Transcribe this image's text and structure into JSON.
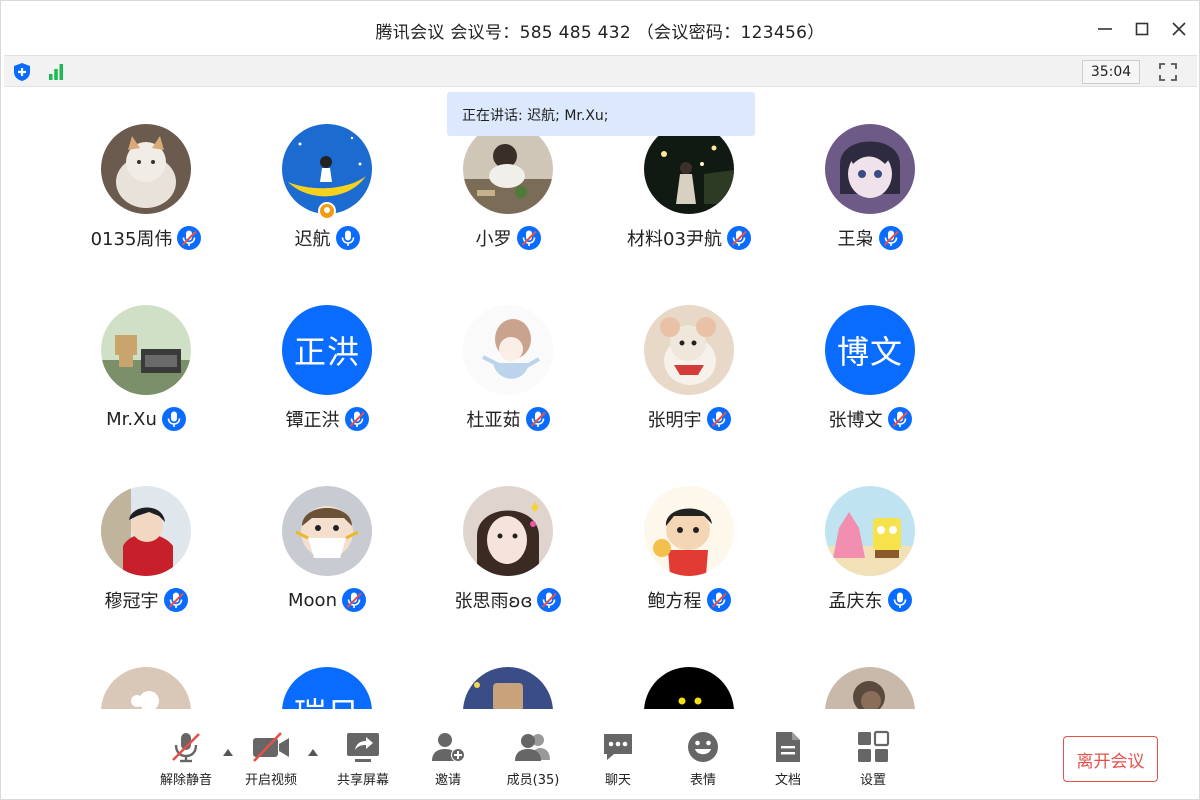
{
  "window": {
    "title": "腾讯会议 会议号：585 485 432 （会议密码：123456）"
  },
  "status": {
    "timer": "35:04",
    "security_icon": "shield-icon",
    "network_icon": "signal-bars-icon"
  },
  "speaking": {
    "text": "正在讲话: 迟航; Mr.Xu;"
  },
  "participants": [
    {
      "name": "0135周伟",
      "avatar": "photo",
      "mic": "muted"
    },
    {
      "name": "迟航",
      "avatar": "photo",
      "mic": "on",
      "host": true
    },
    {
      "name": "小罗",
      "avatar": "photo",
      "mic": "muted"
    },
    {
      "name": "材料03尹航",
      "avatar": "photo",
      "mic": "muted"
    },
    {
      "name": "王枭",
      "avatar": "photo",
      "mic": "muted"
    },
    {
      "name": "Mr.Xu",
      "avatar": "photo",
      "mic": "on"
    },
    {
      "name": "镡正洪",
      "avatar": "text",
      "avatar_text": "正洪",
      "mic": "muted"
    },
    {
      "name": "杜亚茹",
      "avatar": "photo",
      "mic": "muted"
    },
    {
      "name": "张明宇",
      "avatar": "photo",
      "mic": "muted"
    },
    {
      "name": "张博文",
      "avatar": "text",
      "avatar_text": "博文",
      "mic": "muted"
    },
    {
      "name": "穆冠宇",
      "avatar": "photo",
      "mic": "muted"
    },
    {
      "name": "Moon",
      "avatar": "photo",
      "mic": "muted"
    },
    {
      "name": "张思雨ʚɞ",
      "avatar": "photo",
      "mic": "muted"
    },
    {
      "name": "鲍方程",
      "avatar": "photo",
      "mic": "muted"
    },
    {
      "name": "孟庆东",
      "avatar": "photo",
      "mic": "on"
    },
    {
      "name": "",
      "avatar": "photo",
      "mic": "none"
    },
    {
      "name": "",
      "avatar": "text",
      "avatar_text": "瑞日",
      "mic": "none"
    },
    {
      "name": "",
      "avatar": "photo",
      "mic": "none"
    },
    {
      "name": "",
      "avatar": "photo",
      "mic": "none"
    },
    {
      "name": "",
      "avatar": "photo",
      "mic": "none"
    }
  ],
  "toolbar": {
    "unmute": "解除静音",
    "video": "开启视频",
    "share": "共享屏幕",
    "invite": "邀请",
    "members": "成员(35)",
    "chat": "聊天",
    "emoji": "表情",
    "docs": "文档",
    "settings": "设置",
    "leave": "离开会议"
  },
  "colors": {
    "accent": "#0a6cff",
    "leave": "#e2524a",
    "speaking_bg": "#dce9fc"
  }
}
